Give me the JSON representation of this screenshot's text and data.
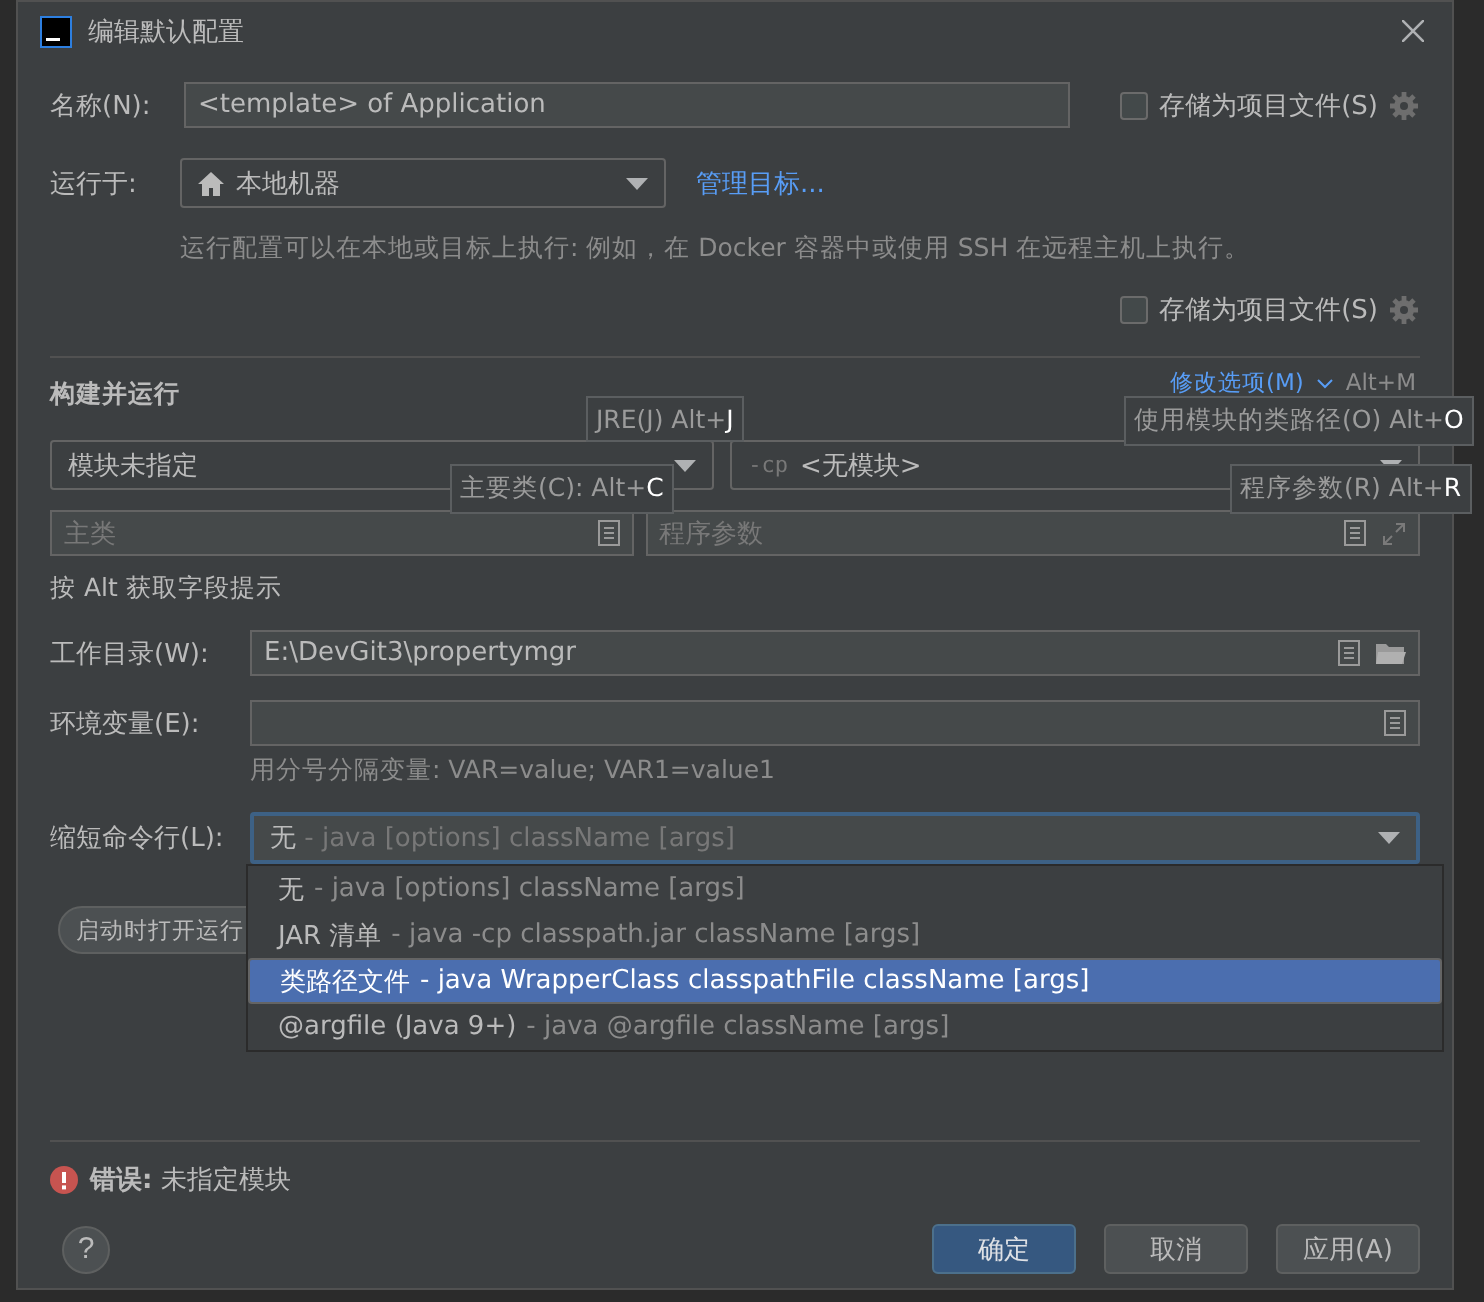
{
  "window": {
    "title": "编辑默认配置"
  },
  "name_row": {
    "label": "名称(N):",
    "value": "<template> of Application",
    "store_checkbox": {
      "label": "存储为项目文件(S)",
      "checked": false
    }
  },
  "run_on": {
    "label": "运行于:",
    "value": "本地机器",
    "link": "管理目标...",
    "hint": "运行配置可以在本地或目标上执行: 例如，在 Docker 容器中或使用 SSH 在远程主机上执行。",
    "store_checkbox": {
      "label": "存储为项目文件(S)",
      "checked": false
    }
  },
  "section": {
    "title": "构建并运行",
    "modify_link": "修改选项(M)",
    "modify_shortcut": "Alt+M"
  },
  "module_select": {
    "value": "模块未指定"
  },
  "classpath_select": {
    "prefix": "-cp",
    "value": "<无模块>"
  },
  "main_class": {
    "placeholder": "主类"
  },
  "program_args": {
    "placeholder": "程序参数"
  },
  "alt_hint": "按 Alt 获取字段提示",
  "tooltips": [
    {
      "text": "JRE(J) Alt+**J**"
    },
    {
      "text": "使用模块的类路径(O) Alt+**O**"
    },
    {
      "text": "主要类(C): Alt+**C**"
    },
    {
      "text": "程序参数(R) Alt+**R**"
    }
  ],
  "working_dir": {
    "label": "工作目录(W):",
    "value": "E:\\DevGit3\\propertymgr"
  },
  "env_vars": {
    "label": "环境变量(E):",
    "hint": "用分号分隔变量: VAR=value; VAR1=value1"
  },
  "shorten": {
    "label": "缩短命令行(L):",
    "value": "无",
    "detail": "- java [options] className [args]"
  },
  "shorten_options": [
    {
      "label": "无",
      "detail": "- java [options] className [args]",
      "selected": false
    },
    {
      "label": "JAR 清单",
      "detail": "- java -cp classpath.jar className [args]",
      "selected": false
    },
    {
      "label": "类路径文件",
      "detail": "- java WrapperClass classpathFile className [args]",
      "selected": true
    },
    {
      "label": "@argfile (Java 9+)",
      "detail": "- java @argfile className [args]",
      "selected": false
    }
  ],
  "open_run_button": "启动时打开运行",
  "error": {
    "label": "错误:",
    "message": "未指定模块"
  },
  "help": "?",
  "buttons": [
    {
      "label": "确定",
      "kind": "primary"
    },
    {
      "label": "取消",
      "kind": "normal"
    },
    {
      "label": "应用(A)",
      "kind": "normal"
    }
  ]
}
